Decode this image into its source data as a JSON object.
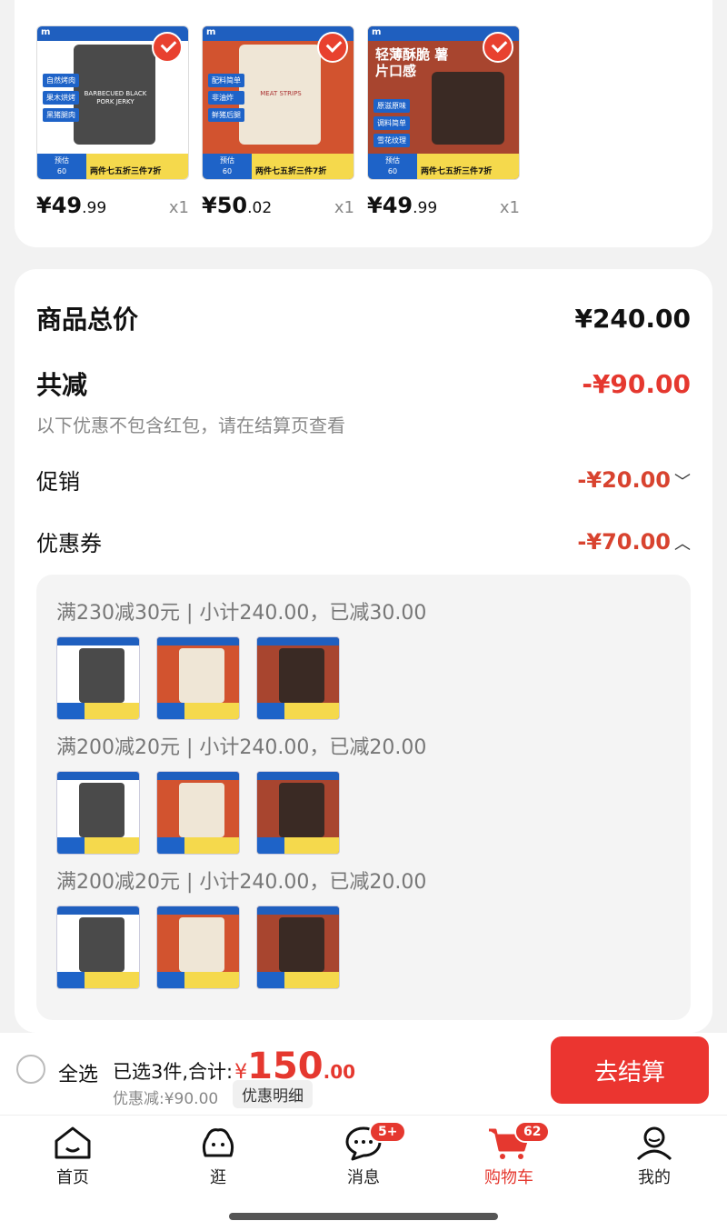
{
  "products": [
    {
      "price_int": "¥49",
      "price_dec": ".99",
      "qty": "x1",
      "thumb_price": "60",
      "thumb_tag": "两件七五折三件7折",
      "features": [
        "自然烤肉",
        "果木烘烤",
        "黑猪腿肉"
      ],
      "bag_text": "BARBECUED BLACK PORK JERKY",
      "bag_color": "#4a4a4a",
      "bg": "#ffffff"
    },
    {
      "price_int": "¥50",
      "price_dec": ".02",
      "qty": "x1",
      "thumb_price": "60",
      "thumb_tag": "两件七五折三件7折",
      "features": [
        "配料简单",
        "非油炸",
        "鲜猪后腿"
      ],
      "bag_text": "MEAT STRIPS",
      "bag_color": "#efe6d6",
      "bg": "#d2532f"
    },
    {
      "price_int": "¥49",
      "price_dec": ".99",
      "qty": "x1",
      "thumb_price": "60",
      "thumb_tag": "两件七五折三件7折",
      "features": [
        "原滋原味",
        "调料简单",
        "雪花纹理"
      ],
      "bag_text": "",
      "head_text": "轻薄酥脆 薯片口感",
      "bag_color": "#3a2a24",
      "bg": "#a8452f"
    }
  ],
  "summary": {
    "total_label": "商品总价",
    "total_value": "¥240.00",
    "reduce_label": "共减",
    "reduce_value": "-¥90.00",
    "note": "以下优惠不包含红包，请在结算页查看",
    "promo_label": "促销",
    "promo_value": "-¥20.00",
    "coupon_label": "优惠券",
    "coupon_value": "-¥70.00"
  },
  "coupons": [
    {
      "title": "满230减30元 | 小计240.00，已减30.00"
    },
    {
      "title": "满200减20元 | 小计240.00，已减20.00"
    },
    {
      "title": "满200减20元 | 小计240.00，已减20.00"
    }
  ],
  "checkout": {
    "select_all": "全选",
    "selected": "已选3件,合计:",
    "yen": "¥",
    "total_int": "150",
    "total_dec": ".00",
    "discount": "优惠减:¥90.00",
    "detail": "优惠明细",
    "pay": "去结算"
  },
  "tabs": [
    {
      "label": "首页",
      "icon": "home-icon"
    },
    {
      "label": "逛",
      "icon": "browse-icon"
    },
    {
      "label": "消息",
      "icon": "message-icon",
      "badge": "5+"
    },
    {
      "label": "购物车",
      "icon": "cart-icon",
      "badge": "62",
      "active": true
    },
    {
      "label": "我的",
      "icon": "profile-icon"
    }
  ],
  "colors": {
    "accent": "#e5382f",
    "pay_button": "#eb3530"
  }
}
